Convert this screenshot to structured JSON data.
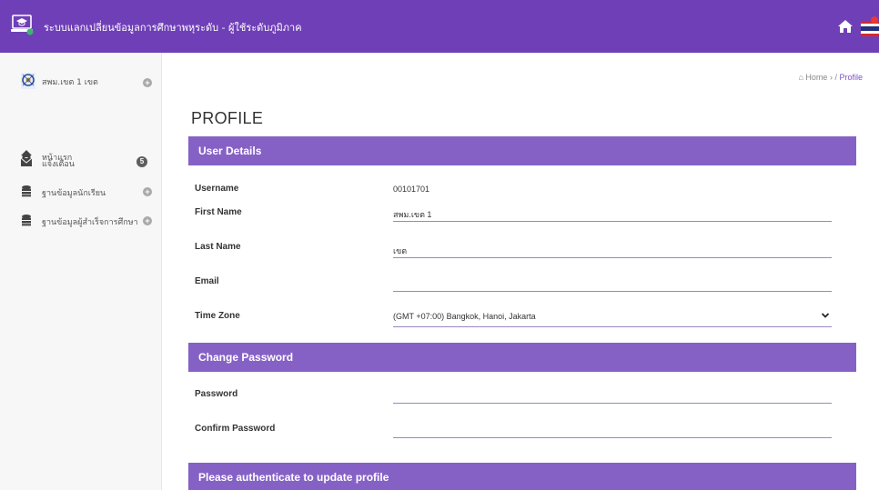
{
  "header": {
    "title": "ระบบแลกเปลี่ยนข้อมูลการศึกษาพหุระดับ - ผู้ใช้ระดับภูมิภาค",
    "accent_color": "#6f3fb7",
    "logo_icon": "laptop-graduation-icon",
    "home_icon": "home-icon",
    "flag_icon": "thai-flag-icon"
  },
  "sidebar": {
    "user": {
      "name": "สพม.เขต 1 เขต",
      "icon": "avatar-icon"
    },
    "items": [
      {
        "label": "หน้าแรก",
        "icon": "home-icon"
      },
      {
        "label": "แจ้งเตือน",
        "icon": "envelope-icon",
        "badge": "5"
      },
      {
        "label": "ฐานข้อมูลนักเรียน",
        "icon": "database-icon"
      },
      {
        "label": "ฐานข้อมูลผู้สำเร็จการศึกษา",
        "icon": "database-icon"
      }
    ]
  },
  "breadcrumb": {
    "home": "Home",
    "separator": "/",
    "current": "Profile"
  },
  "page": {
    "title": "PROFILE"
  },
  "user_details": {
    "heading": "User Details",
    "username_label": "Username",
    "username_value": "00101701",
    "firstname_label": "First Name",
    "firstname_value": "สพม.เขต 1",
    "lastname_label": "Last Name",
    "lastname_value": "เขต",
    "email_label": "Email",
    "email_value": "",
    "timezone_label": "Time Zone",
    "timezone_value": "(GMT +07:00) Bangkok, Hanoi, Jakarta"
  },
  "change_password": {
    "heading": "Change Password",
    "password_label": "Password",
    "confirm_label": "Confirm Password"
  },
  "authenticate": {
    "heading": "Please authenticate to update profile"
  }
}
